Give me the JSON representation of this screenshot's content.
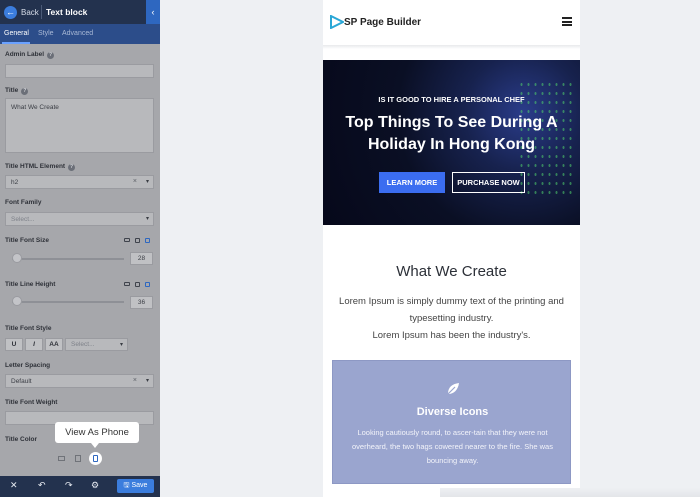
{
  "panel": {
    "back_label": "Back",
    "title": "Text block",
    "collapse_glyph": "‹",
    "tabs": [
      {
        "label": "General",
        "active": true
      },
      {
        "label": "Style",
        "active": false
      },
      {
        "label": "Advanced",
        "active": false
      }
    ],
    "fields": {
      "admin_label": {
        "label": "Admin Label",
        "value": ""
      },
      "title": {
        "label": "Title",
        "value": "What We Create"
      },
      "html_element": {
        "label": "Title HTML Element",
        "value": "h2"
      },
      "font_family": {
        "label": "Font Family",
        "placeholder": "Select..."
      },
      "font_size": {
        "label": "Title Font Size",
        "value": "28"
      },
      "line_height": {
        "label": "Title Line Height",
        "value": "36"
      },
      "font_style": {
        "label": "Title Font Style",
        "buttons": [
          "U",
          "I",
          "AA"
        ],
        "placeholder": "Select..."
      },
      "letter_spacing": {
        "label": "Letter Spacing",
        "value": "Default"
      },
      "font_weight": {
        "label": "Title Font Weight"
      },
      "color": {
        "label": "Title Color"
      }
    },
    "help_glyph": "?",
    "clear_glyph": "×",
    "caret_glyph": "▾",
    "tooltip": "View As Phone",
    "bottom": {
      "close_icon": "✕",
      "undo_icon": "↶",
      "redo_icon": "↷",
      "settings_icon": "⚙",
      "save_label": "Save"
    }
  },
  "preview": {
    "brand": "SP Page Builder",
    "hero": {
      "kicker": "IS IT GOOD TO HIRE A PERSONAL CHEF",
      "title": "Top Things To See During A Holiday In Hong Kong",
      "primary_button": "LEARN MORE",
      "secondary_button": "PURCHASE NOW"
    },
    "section": {
      "title": "What We Create",
      "body1": "Lorem Ipsum is simply dummy text of the printing and typesetting industry.",
      "body2": "Lorem Ipsum has been the industry's."
    },
    "card": {
      "title": "Diverse Icons",
      "body": "Looking cautiously round, to ascer-tain that they were not overheard, the two hags cowered nearer to the fire. She was bouncing away."
    }
  },
  "colors": {
    "accent": "#3b7ddd",
    "panel_dark": "#23324e",
    "hero_button": "#3b6df0",
    "card": "#9aa5cf"
  }
}
